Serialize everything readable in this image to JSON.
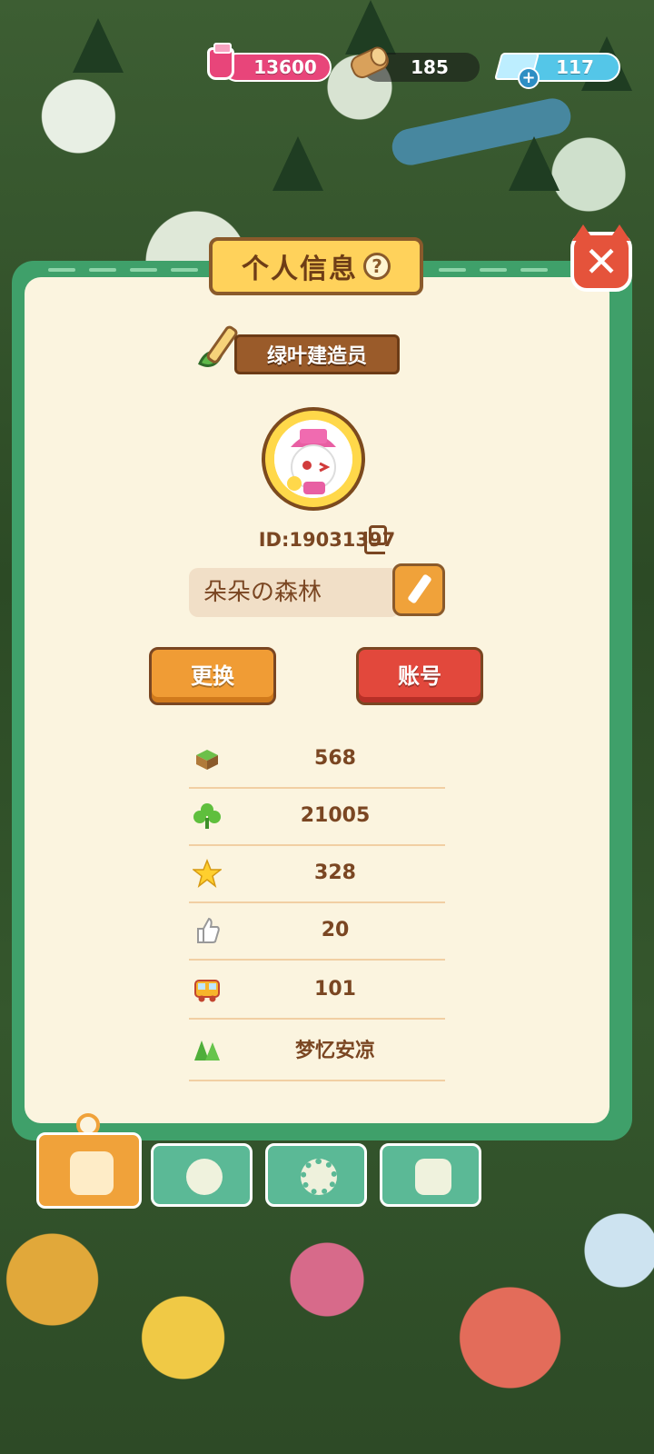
{
  "resources": {
    "jar_value": "13600",
    "wood_value": "185",
    "gem_value": "117"
  },
  "panel": {
    "title": "个人信息",
    "help_symbol": "?",
    "close_symbol": "✕"
  },
  "profile": {
    "rank_title": "绿叶建造员",
    "id_text": "ID:19031397",
    "nickname": "朵朵の森林"
  },
  "buttons": {
    "change_label": "更换",
    "account_label": "账号"
  },
  "stats": [
    {
      "icon": "grass-block-icon",
      "value": "568"
    },
    {
      "icon": "clover-icon",
      "value": "21005"
    },
    {
      "icon": "star-icon",
      "value": "328"
    },
    {
      "icon": "thumbs-up-icon",
      "value": "20"
    },
    {
      "icon": "bus-icon",
      "value": "101"
    },
    {
      "icon": "trees-icon",
      "value": "梦忆安凉"
    }
  ],
  "tabs": [
    {
      "name": "tab-profile",
      "icon": "cat-card-icon",
      "active": true
    },
    {
      "name": "tab-badge",
      "icon": "flower-badge-icon",
      "active": false
    },
    {
      "name": "tab-settings",
      "icon": "gear-icon",
      "active": false
    },
    {
      "name": "tab-album",
      "icon": "photo-album-icon",
      "active": false
    }
  ],
  "colors": {
    "panel_green": "#3fa06a",
    "panel_bg": "#fbf4df",
    "text_brown": "#7a4622",
    "accent_orange": "#f0a23a",
    "accent_red": "#e2483c"
  }
}
